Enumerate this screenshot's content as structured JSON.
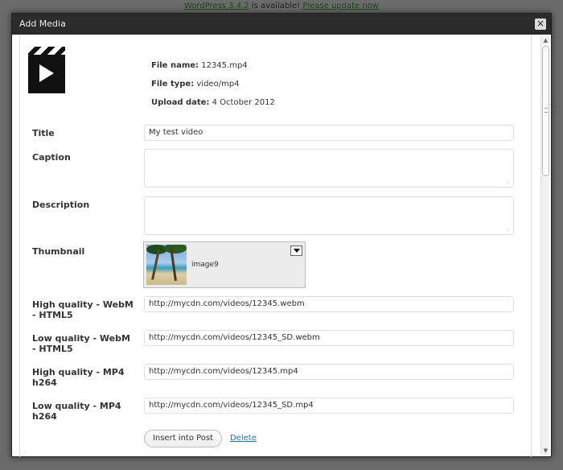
{
  "background": {
    "notice_version": "WordPress 3.4.2",
    "notice_middle": " is available! ",
    "notice_link": "Please update now"
  },
  "modal": {
    "title": "Add Media",
    "close_symbol": "×"
  },
  "file": {
    "icon": "video-file-icon",
    "name_label": "File name:",
    "name_value": "12345.mp4",
    "type_label": "File type:",
    "type_value": "video/mp4",
    "date_label": "Upload date:",
    "date_value": "4 October 2012"
  },
  "fields": {
    "title_label": "Title",
    "title_value": "My test video",
    "caption_label": "Caption",
    "caption_value": "",
    "description_label": "Description",
    "description_value": "",
    "thumbnail_label": "Thumbnail",
    "thumbnail_name": "image9",
    "hq_webm_label": "High quality - WebM - HTML5",
    "hq_webm_value": "http://mycdn.com/videos/12345.webm",
    "lq_webm_label": "Low quality - WebM - HTML5",
    "lq_webm_value": "http://mycdn.com/videos/12345_SD.webm",
    "hq_mp4_label": "High quality - MP4 h264",
    "hq_mp4_value": "http://mycdn.com/videos/12345.mp4",
    "lq_mp4_label": "Low quality - MP4 h264",
    "lq_mp4_value": "http://mycdn.com/videos/12345_SD.mp4"
  },
  "actions": {
    "insert_label": "Insert into Post",
    "delete_label": "Delete"
  },
  "colors": {
    "header_bg": "#2b2b2b",
    "link": "#21759b"
  }
}
